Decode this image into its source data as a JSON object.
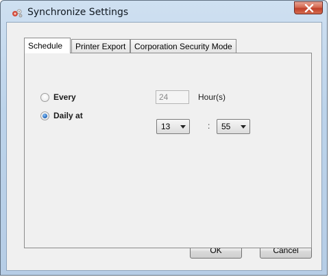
{
  "window": {
    "title": "Synchronize Settings",
    "close_icon": "close-icon",
    "app_icon": "sync-settings-icon"
  },
  "tabs": [
    {
      "label": "Schedule",
      "active": true
    },
    {
      "label": "Printer Export",
      "active": false
    },
    {
      "label": "Corporation Security Mode",
      "active": false
    }
  ],
  "schedule": {
    "every": {
      "label": "Every",
      "selected": false,
      "value": "24",
      "unit_label": "Hour(s)"
    },
    "daily": {
      "label": "Daily at",
      "selected": true,
      "hour": "13",
      "separator": ":",
      "minute": "55"
    }
  },
  "buttons": {
    "ok_label": "OK",
    "cancel_label": "Cancel"
  },
  "colors": {
    "accent": "#2a6fc2",
    "close_button": "#c0402a"
  }
}
